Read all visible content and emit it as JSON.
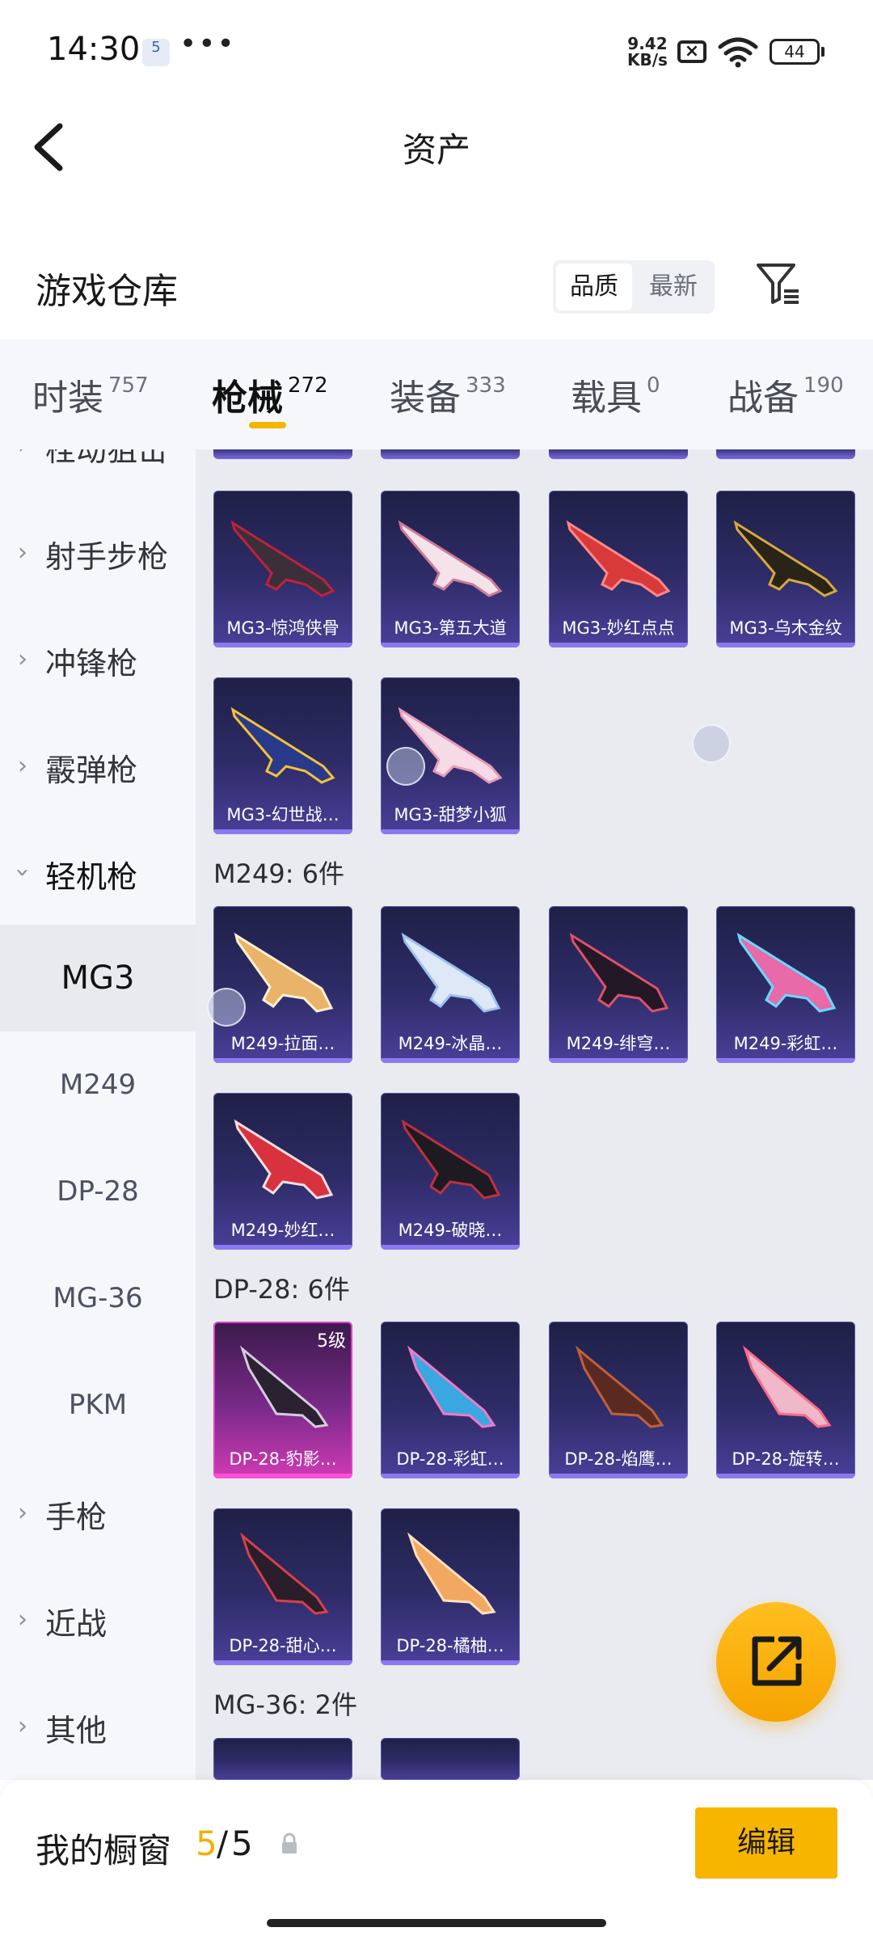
{
  "status_bar": {
    "time": "14:30",
    "badge": "5",
    "more": "•••",
    "speed_value": "9.42",
    "speed_unit": "KB/s",
    "battery": "44"
  },
  "header": {
    "title": "资产",
    "back_icon": "chevron-left-icon"
  },
  "section": {
    "title": "游戏仓库",
    "sort_options": [
      "品质",
      "最新"
    ],
    "sort_selected": "品质",
    "filter_icon": "filter-icon"
  },
  "tabs": [
    {
      "label": "时装",
      "count": "757"
    },
    {
      "label": "枪械",
      "count": "272",
      "active": true
    },
    {
      "label": "装备",
      "count": "333"
    },
    {
      "label": "载具",
      "count": "0"
    },
    {
      "label": "战备",
      "count": "190"
    }
  ],
  "sidebar": {
    "items": [
      {
        "label": "射手步枪",
        "expanded": false
      },
      {
        "label": "冲锋枪",
        "expanded": false
      },
      {
        "label": "霰弹枪",
        "expanded": false
      },
      {
        "label": "轻机枪",
        "expanded": true
      }
    ],
    "subitems": [
      "MG3",
      "M249",
      "DP-28",
      "MG-36",
      "PKM"
    ],
    "active_subitem": "MG3",
    "more_items": [
      "手枪",
      "近战",
      "其他"
    ],
    "partial_top": "栓动狙击"
  },
  "groups": {
    "mg3": {
      "cards": [
        "MG3-惊鸿侠骨",
        "MG3-第五大道",
        "MG3-妙红点点",
        "MG3-乌木金纹",
        "MG3-幻世战…",
        "MG3-甜梦小狐"
      ]
    },
    "m249": {
      "title": "M249: 6件",
      "cards": [
        "M249-拉面…",
        "M249-冰晶…",
        "M249-绯穹…",
        "M249-彩虹…",
        "M249-妙红…",
        "M249-破晓…"
      ]
    },
    "dp28": {
      "title": "DP-28: 6件",
      "level_badge": "5级",
      "cards": [
        "DP-28-豹影…",
        "DP-28-彩虹…",
        "DP-28-焰鹰…",
        "DP-28-旋转…",
        "DP-28-甜心…",
        "DP-28-橘柚…"
      ]
    },
    "mg36": {
      "title": "MG-36: 2件"
    }
  },
  "bottom": {
    "label": "我的橱窗",
    "count": "5",
    "separator": "/",
    "total": "5",
    "edit_label": "编辑",
    "share_icon": "share-icon",
    "lock_icon": "lock-icon"
  },
  "colors": {
    "accent": "#f7b500",
    "card_base": "#2e2c68",
    "card_rare": "#d03ab4"
  }
}
